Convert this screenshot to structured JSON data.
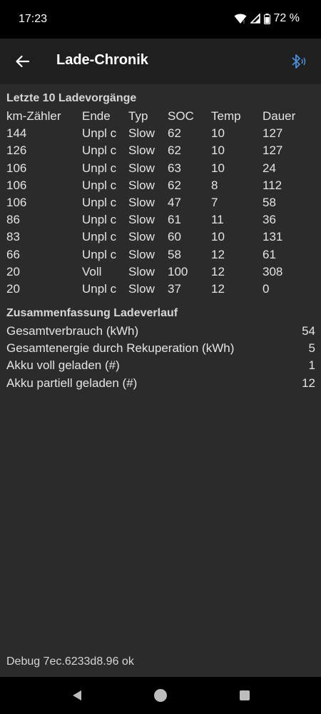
{
  "status": {
    "time": "17:23",
    "battery": "72 %"
  },
  "appbar": {
    "title": "Lade-Chronik",
    "back_icon": "arrow-left-icon",
    "bt_icon": "bluetooth-icon"
  },
  "history": {
    "title": "Letzte 10 Ladevorgänge",
    "headers": [
      "km-Zähler",
      "Ende",
      "Typ",
      "SOC",
      "Temp",
      "Dauer"
    ],
    "rows": [
      [
        "144",
        "Unpl c",
        "Slow",
        "62",
        "10",
        "127"
      ],
      [
        "126",
        "Unpl c",
        "Slow",
        "62",
        "10",
        "127"
      ],
      [
        "106",
        "Unpl c",
        "Slow",
        "63",
        "10",
        "24"
      ],
      [
        "106",
        "Unpl c",
        "Slow",
        "62",
        "8",
        "112"
      ],
      [
        "106",
        "Unpl c",
        "Slow",
        "47",
        "7",
        "58"
      ],
      [
        "86",
        "Unpl c",
        "Slow",
        "61",
        "11",
        "36"
      ],
      [
        "83",
        "Unpl c",
        "Slow",
        "60",
        "10",
        "131"
      ],
      [
        "66",
        "Unpl c",
        "Slow",
        "58",
        "12",
        "61"
      ],
      [
        "20",
        "Voll",
        "Slow",
        "100",
        "12",
        "308"
      ],
      [
        "20",
        "Unpl c",
        "Slow",
        "37",
        "12",
        "0"
      ]
    ]
  },
  "summary": {
    "title": "Zusammenfassung Ladeverlauf",
    "items": [
      {
        "label": "Gesamtverbrauch (kWh)",
        "value": "54"
      },
      {
        "label": "Gesamtenergie durch Rekuperation (kWh)",
        "value": "5"
      },
      {
        "label": "Akku voll geladen (#)",
        "value": "1"
      },
      {
        "label": "Akku partiell geladen (#)",
        "value": "12"
      }
    ]
  },
  "debug": "Debug 7ec.6233d8.96 ok",
  "colors": {
    "background": "#2b2b2b",
    "appbar": "#1f1f1f",
    "bluetooth": "#4a8fd8"
  }
}
